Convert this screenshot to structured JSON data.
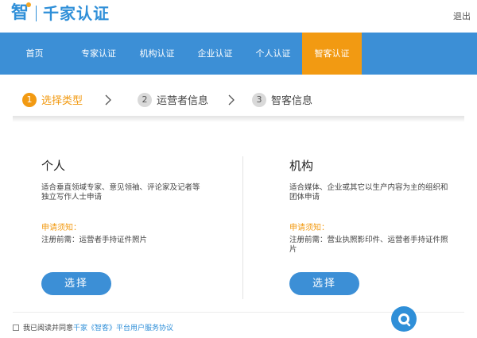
{
  "header": {
    "logo_mark": "智",
    "logo_text": "千家认证",
    "logout": "退出"
  },
  "nav": {
    "items": [
      {
        "label": "首页"
      },
      {
        "label": "专家认证"
      },
      {
        "label": "机构认证"
      },
      {
        "label": "企业认证"
      },
      {
        "label": "个人认证"
      },
      {
        "label": "智客认证",
        "active": true
      }
    ]
  },
  "steps": [
    {
      "num": "1",
      "label": "选择类型",
      "active": true
    },
    {
      "num": "2",
      "label": "运营者信息"
    },
    {
      "num": "3",
      "label": "智客信息"
    }
  ],
  "cards": {
    "personal": {
      "title": "个人",
      "desc": "适合垂直领域专家、意见领袖、评论家及记者等独立写作人士申请",
      "note_title": "申请须知：",
      "note": "注册前需：运营者手持证件照片",
      "button": "选择"
    },
    "organization": {
      "title": "机构",
      "desc": "适合媒体、企业或其它以生产内容为主的组织和团体申请",
      "note_title": "申请须知：",
      "note": "注册前需：营业执照影印件、运营者手持证件照片",
      "button": "选择"
    }
  },
  "agreement": {
    "text": "我已阅读并同意",
    "link": "千家《智客》平台用户服务协议"
  },
  "colors": {
    "brand_blue": "#3c8fd6",
    "accent_orange": "#f29a12"
  }
}
